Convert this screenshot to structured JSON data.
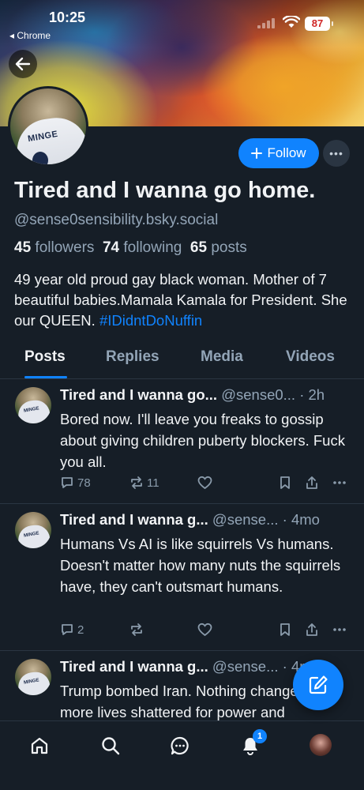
{
  "status_bar": {
    "time": "10:25",
    "back_app": "◂ Chrome",
    "battery": "87"
  },
  "profile": {
    "display_name": "Tired and I wanna go home.",
    "handle": "@sense0sensibility.bsky.social",
    "followers_count": "45",
    "followers_label": "followers",
    "following_count": "74",
    "following_label": "following",
    "posts_count": "65",
    "posts_label": "posts",
    "bio_text": "49 year old proud gay black woman. Mother of 7 beautiful babies.Mamala Kamala for President. She our QUEEN. ",
    "bio_hashtag": "#IDidntDoNuffin",
    "avatar_shirt_text": "MINGE",
    "follow_label": "Follow",
    "more_label": "•••"
  },
  "tabs": [
    {
      "label": "Posts",
      "active": true
    },
    {
      "label": "Replies",
      "active": false
    },
    {
      "label": "Media",
      "active": false
    },
    {
      "label": "Videos",
      "active": false
    }
  ],
  "posts": [
    {
      "name": "Tired and I wanna go...",
      "handle": "@sense0...",
      "time": "· 2h",
      "text": "Bored now. I'll leave you freaks to gossip about giving children puberty blockers. Fuck you all.",
      "replies": "78",
      "reposts": "11",
      "avatar_text": "MINGE"
    },
    {
      "name": "Tired and I wanna g...",
      "handle": "@sense...",
      "time": "· 4mo",
      "text": "Humans Vs AI is like squirrels Vs humans. Doesn't matter how many nuts the squirrels have, they can't outsmart humans.",
      "replies": "2",
      "reposts": "",
      "avatar_text": "MINGE"
    },
    {
      "name": "Tired and I wanna g...",
      "handle": "@sense...",
      "time": "· 4mo",
      "text": "Trump bombed Iran. Nothing changed, just more lives shattered for power and",
      "replies": "",
      "reposts": "",
      "avatar_text": "MINGE"
    }
  ],
  "bottom_nav": {
    "notifications_badge": "1",
    "icons": [
      "home-icon",
      "search-icon",
      "chat-icon",
      "bell-icon",
      "profile-avatar"
    ]
  },
  "colors": {
    "background": "#161e27",
    "accent": "#1083fe",
    "muted": "#93a5b7",
    "text": "#f1f3f5"
  }
}
